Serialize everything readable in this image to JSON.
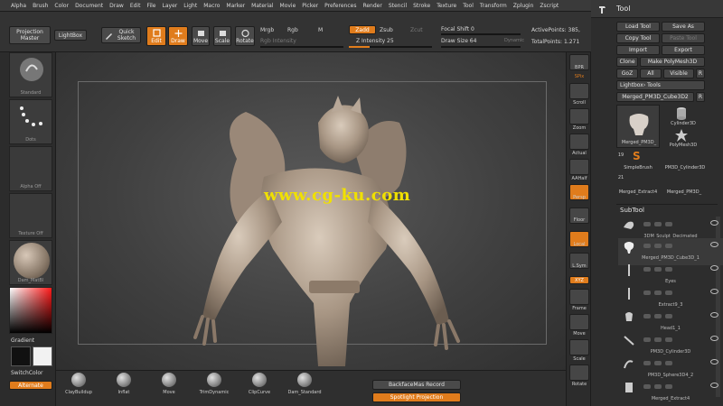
{
  "menu": [
    "Alpha",
    "Brush",
    "Color",
    "Document",
    "Draw",
    "Edit",
    "File",
    "Layer",
    "Light",
    "Macro",
    "Marker",
    "Material",
    "Movie",
    "Picker",
    "Preferences",
    "Render",
    "Stencil",
    "Stroke",
    "Texture",
    "Tool",
    "Transform",
    "Zplugin",
    "Zscript"
  ],
  "top_shelf": {
    "projection_master": "Projection Master",
    "lightbox": "LightBox",
    "quick_sketch": "Quick Sketch",
    "edit": "Edit",
    "draw": "Draw",
    "move": "Move",
    "scale": "Scale",
    "rotate": "Rotate",
    "mrgb": "Mrgb",
    "rgb": "Rgb",
    "m": "M",
    "zadd": "Zadd",
    "zsub": "Zsub",
    "zcut": "Zcut",
    "rgb_intensity": "Rgb Intensity",
    "z_intensity": "Z Intensity 25",
    "z_intensity_value": 25,
    "focal_shift": "Focal Shift 0",
    "draw_size": "Draw Size 64",
    "dynamic": "Dynamic",
    "active_points": "ActivePoints: 385,",
    "total_points": "TotalPoints: 1.271"
  },
  "left_shelf": {
    "standard": "Standard",
    "dots": "Dots",
    "alpha_off": "Alpha Off",
    "texture_off": "Texture Off",
    "material": "Dam_MatBl",
    "gradient": "Gradient",
    "switch_color": "SwitchColor",
    "alternate": "Alternate"
  },
  "canvas": {
    "watermark": "www.cg-ku.com"
  },
  "bottom_shelf": {
    "brushes": [
      "ClayBuildup",
      "Inflat",
      "Move",
      "TrimDynamic",
      "ClipCurve",
      "Dam_Standard"
    ],
    "backface": "BackfaceMas Record",
    "spotlight": "Spotlight Projection"
  },
  "right_shelf": [
    "BPR",
    "SPix",
    "Scroll",
    "Zoom",
    "Actual",
    "AAHalf",
    "Persp",
    "Floor",
    "Local",
    "L.Sym",
    "XYZ",
    "Frame",
    "Move",
    "Scale",
    "Rotate"
  ],
  "tool_palette": {
    "title": "Tool",
    "buttons": [
      "Load Tool",
      "Save As",
      "Copy Tool",
      "Paste Tool",
      "Import",
      "Export",
      "Clone",
      "Make PolyMesh3D",
      "GoZ",
      "All",
      "Visible",
      "R",
      "Lightbox› Tools",
      "Merged_PM3D_Cube3D2",
      "R"
    ],
    "thumbs": [
      "Merged_PM3D_",
      "Cylinder3D",
      "PolyMesh3D",
      "SimpleBrush",
      "PM3D_Cylinder3D",
      "Merged_Extract4",
      "Merged_PM3D_"
    ],
    "thumb_counts": [
      "19",
      "21"
    ],
    "subtool_title": "SubTool",
    "subtools": [
      "3DM_Sculpt_Decimated",
      "Merged_PM3D_Cube3D_1",
      "Eyes",
      "Extract9_3",
      "Head1_1",
      "PM3D_Cylinder3D",
      "PM3D_Sphere3D4_2",
      "Merged_Extract4"
    ]
  },
  "colors": {
    "accent": "#e07c1c",
    "panel": "#2d2d2d",
    "watermark": "#f0e000"
  }
}
